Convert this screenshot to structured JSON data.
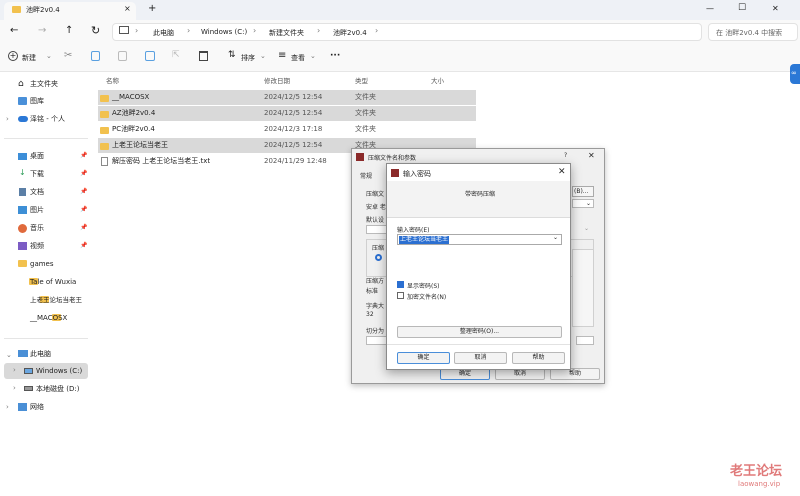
{
  "window": {
    "tab_title": "池畔2v0.4",
    "tab_close": "×",
    "tab_add": "+",
    "minimize": "—",
    "maximize": "☐",
    "close": "✕"
  },
  "address": {
    "crumbs": [
      "此电脑",
      "Windows (C:)",
      "新建文件夹",
      "池畔2v0.4"
    ],
    "search_placeholder": "在 池畔2v0.4 中搜索"
  },
  "toolbar": {
    "new_label": "新建",
    "sort_label": "排序",
    "view_label": "查看",
    "more_label": "···"
  },
  "sidebar": {
    "home": "主文件夹",
    "gallery": "图库",
    "cloud": "泽铭 - 个人",
    "quick": [
      {
        "label": "桌面"
      },
      {
        "label": "下载"
      },
      {
        "label": "文档"
      },
      {
        "label": "图片"
      },
      {
        "label": "音乐"
      },
      {
        "label": "视频"
      },
      {
        "label": "games"
      },
      {
        "label": "Tale of Wuxia"
      },
      {
        "label": "上老王论坛当老王"
      },
      {
        "label": "__MACOSX"
      }
    ],
    "pc": "此电脑",
    "drive_c": "Windows (C:)",
    "drive_d": "本地磁盘 (D:)",
    "network": "网络"
  },
  "columns": {
    "name": "名称",
    "date": "修改日期",
    "type": "类型",
    "size": "大小"
  },
  "files": [
    {
      "name": "__MACOSX",
      "date": "2024/12/5 12:54",
      "type": "文件夹",
      "selected": true,
      "kind": "folder"
    },
    {
      "name": "AZ池畔2v0.4",
      "date": "2024/12/5 12:54",
      "type": "文件夹",
      "selected": true,
      "kind": "folder"
    },
    {
      "name": "PC池畔2v0.4",
      "date": "2024/12/3 17:18",
      "type": "文件夹",
      "selected": false,
      "kind": "folder"
    },
    {
      "name": "上老王论坛当老王",
      "date": "2024/12/5 12:54",
      "type": "文件夹",
      "selected": true,
      "kind": "folder"
    },
    {
      "name": "解压密码 上老王论坛当老王.txt",
      "date": "2024/11/29 12:48",
      "type": "文本文档",
      "selected": false,
      "kind": "file"
    }
  ],
  "back_dialog": {
    "title": "压缩文件名和参数",
    "help": "?",
    "tab_general": "常规",
    "fragments": [
      "压缩文",
      "安卓 老",
      "默认设",
      "压缩",
      "压缩方",
      "标准",
      "字典大",
      "32",
      "切分为"
    ],
    "ok": "确定",
    "cancel": "取消",
    "help_btn": "帮助",
    "browse_tail": "(B)..."
  },
  "front_dialog": {
    "title": "输入密码",
    "heading": "带密码压缩",
    "field_label": "输入密码(E)",
    "field_value": "上老王论坛当老王",
    "show_password": "显示密码(S)",
    "show_checked": true,
    "encrypt_names": "加密文件名(N)",
    "encrypt_checked": false,
    "organize_btn": "整理密码(O)...",
    "ok": "确定",
    "cancel": "取消",
    "help": "帮助"
  },
  "watermark": {
    "title": "老王论坛",
    "url": "laowang.vip"
  },
  "colors": {
    "accent": "#2b6fd1",
    "selection": "#d9d9d9",
    "folder": "#f2c14e",
    "watermark": "#e07a7a"
  }
}
